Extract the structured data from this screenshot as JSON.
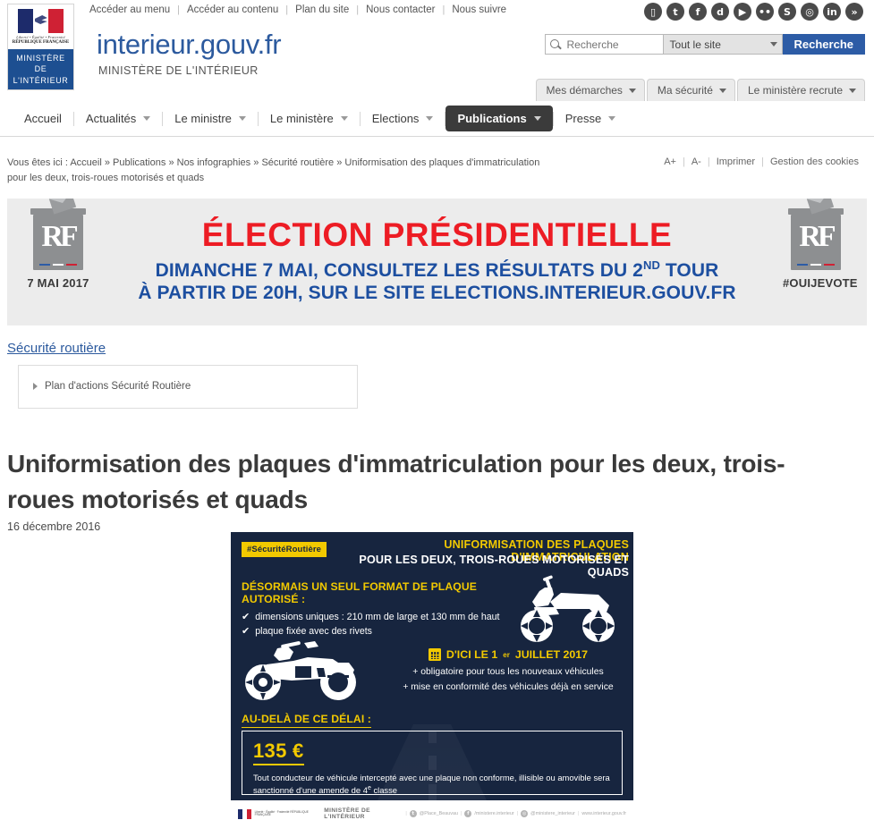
{
  "topbar": {
    "links": [
      {
        "label": "Accéder au menu"
      },
      {
        "label": "Accéder au contenu"
      },
      {
        "label": "Plan du site"
      },
      {
        "label": "Nous contacter"
      },
      {
        "label": "Nous suivre"
      }
    ],
    "social_icons": [
      {
        "name": "mobile-icon",
        "glyph": "▯"
      },
      {
        "name": "twitter-icon",
        "glyph": "t"
      },
      {
        "name": "facebook-icon",
        "glyph": "f"
      },
      {
        "name": "dailymotion-icon",
        "glyph": "d"
      },
      {
        "name": "youtube-icon",
        "glyph": "▶"
      },
      {
        "name": "flickr-icon",
        "glyph": "••"
      },
      {
        "name": "scoopit-icon",
        "glyph": "S"
      },
      {
        "name": "instagram-icon",
        "glyph": "◎"
      },
      {
        "name": "linkedin-icon",
        "glyph": "in"
      },
      {
        "name": "rss-icon",
        "glyph": "»"
      }
    ]
  },
  "brand": {
    "logo_devise": "Liberté • Égalité • Fraternité",
    "logo_republique": "RÉPUBLIQUE FRANÇAISE",
    "logo_ministere_line1": "MINISTÈRE",
    "logo_ministere_line2": "DE",
    "logo_ministere_line3": "L'INTÉRIEUR",
    "site_title": "interieur.gouv.fr",
    "site_subtitle": "MINISTÈRE DE L'INTÉRIEUR"
  },
  "search": {
    "placeholder": "Recherche",
    "value": "",
    "scope_selected": "Tout le site",
    "submit_label": "Recherche"
  },
  "secondary_tabs": [
    {
      "label": "Mes démarches"
    },
    {
      "label": "Ma sécurité"
    },
    {
      "label": "Le ministère recrute"
    }
  ],
  "mainnav": [
    {
      "label": "Accueil",
      "has_caret": false,
      "active": false
    },
    {
      "label": "Actualités",
      "has_caret": true,
      "active": false
    },
    {
      "label": "Le ministre",
      "has_caret": true,
      "active": false
    },
    {
      "label": "Le ministère",
      "has_caret": true,
      "active": false
    },
    {
      "label": "Elections",
      "has_caret": true,
      "active": false
    },
    {
      "label": "Publications",
      "has_caret": true,
      "active": true
    },
    {
      "label": "Presse",
      "has_caret": true,
      "active": false
    }
  ],
  "breadcrumb": {
    "prefix": "Vous êtes ici :",
    "items": [
      "Accueil",
      "Publications",
      "Nos infographies",
      "Sécurité routière",
      "Uniformisation des plaques d'immatriculation pour les deux, trois-roues motorisés et quads"
    ],
    "separator": "»"
  },
  "page_tools": [
    {
      "label": "A+"
    },
    {
      "label": "A-"
    },
    {
      "label": "Imprimer"
    },
    {
      "label": "Gestion des cookies"
    }
  ],
  "banner": {
    "title": "ÉLECTION PRÉSIDENTIELLE",
    "line1_a": "DIMANCHE 7 MAI, CONSULTEZ LES RÉSULTATS DU 2",
    "line1_sup": "ND",
    "line1_b": " TOUR",
    "line2": "À PARTIR DE 20H, SUR LE SITE ELECTIONS.INTERIEUR.GOUV.FR",
    "left_caption": "7 MAI 2017",
    "right_caption": "#OUIJEVOTE",
    "urn_monogram": "RF",
    "title_color": "#ed1c24",
    "subtitle_color": "#1d4fa0",
    "background": "#ececec"
  },
  "section": {
    "link_label": "Sécurité routière",
    "subnav": [
      {
        "label": "Plan d'actions Sécurité Routière"
      }
    ]
  },
  "article": {
    "title": "Uniformisation des plaques d'immatriculation pour les deux, trois-roues motorisés et quads",
    "date": "16 décembre 2016"
  },
  "infographic": {
    "hashtag": "#SécuritéRoutière",
    "heading_line1": "UNIFORMISATION DES PLAQUES D'IMMATRICULATION",
    "heading_line2": "POUR LES DEUX, TROIS-ROUES MOTORISÉS ET QUADS",
    "section1_title": "DÉSORMAIS UN SEUL FORMAT DE PLAQUE AUTORISÉ :",
    "bullets": [
      "dimensions uniques : 210 mm de large et 130 mm de haut",
      "plaque fixée avec des rivets"
    ],
    "deadline_prefix": "D'ICI LE 1",
    "deadline_sup": "er",
    "deadline_suffix": " JUILLET 2017",
    "deadline_notes": [
      "+ obligatoire pour tous les nouveaux véhicules",
      "+ mise en conformité des véhicules déjà en service"
    ],
    "section2_title": "AU-DELÀ DE CE DÉLAI :",
    "fine_amount": "135 €",
    "fine_text_a": "Tout conducteur de véhicule intercepté avec une plaque non conforme, illisible ou amovible sera sanctionné d'une amende de 4",
    "fine_text_sup": "e",
    "fine_text_b": " classe",
    "colors": {
      "background": "#17253f",
      "accent_yellow": "#f2c900",
      "text_white": "#ffffff"
    },
    "footer": {
      "ministry": "MINISTÈRE DE L'INTÉRIEUR",
      "republique": "Liberté · Égalité · Fraternité RÉPUBLIQUE FRANÇAISE",
      "handles": [
        {
          "icon": "twitter-icon",
          "glyph": "t",
          "label": "@Place_Beauvau"
        },
        {
          "icon": "facebook-icon",
          "glyph": "f",
          "label": "/ministere.interieur"
        },
        {
          "icon": "instagram-icon",
          "glyph": "◎",
          "label": "@ministere_interieur"
        }
      ],
      "website": "www.interieur.gouv.fr"
    }
  }
}
